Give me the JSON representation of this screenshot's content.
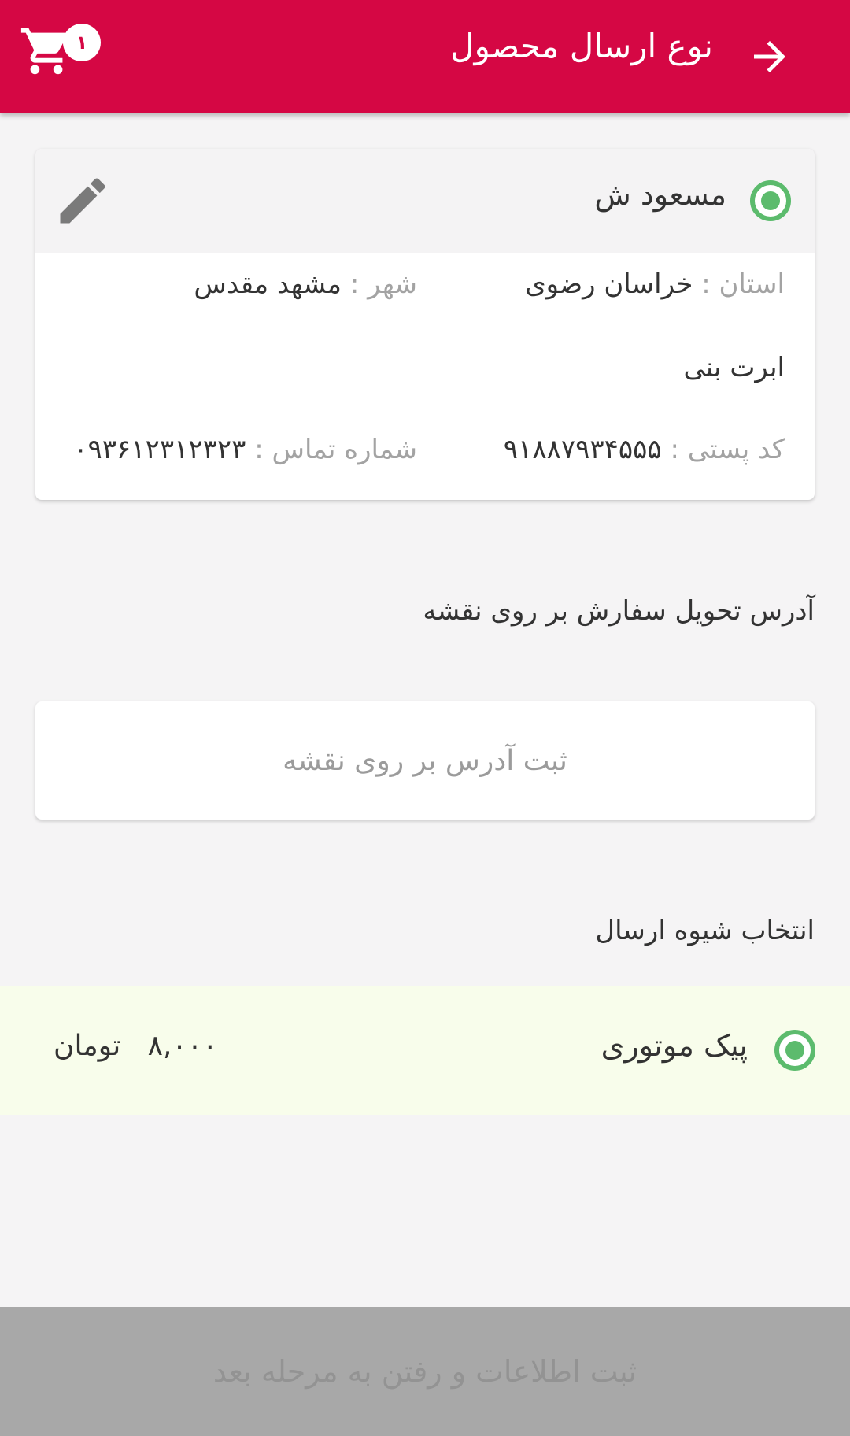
{
  "header": {
    "title": "نوع ارسال محصول",
    "back_icon": "arrow-right-icon",
    "cart_icon": "cart-icon",
    "cart_badge": "۱",
    "color": "#d50744"
  },
  "address_card": {
    "name": "مسعود ش",
    "selected": true,
    "edit_icon": "pencil-icon",
    "province_label": "استان :",
    "province_value": "خراسان رضوی",
    "city_label": "شهر :",
    "city_value": "مشهد مقدس",
    "address": "ابرت بنی",
    "postal_label": "کد پستی :",
    "postal_value": "۹۱۸۸۷۹۳۴۵۵۵",
    "phone_label": "شماره تماس :",
    "phone_value": "۰۹۳۶۱۲۳۱۲۳۲۳"
  },
  "map_section": {
    "title": "آدرس تحویل سفارش بر روی نقشه",
    "button_label": "ثبت آدرس بر روی نقشه"
  },
  "shipping_section": {
    "title": "انتخاب شیوه ارسال",
    "options": [
      {
        "name": "پیک موتوری",
        "price": "۸,۰۰۰",
        "currency": "تومان",
        "selected": true
      }
    ]
  },
  "footer": {
    "submit_label": "ثبت اطلاعات و رفتن به مرحله بعد"
  },
  "colors": {
    "accent": "#d50744",
    "radio": "#5cbb6d",
    "selected_row_bg": "#f8fdeb",
    "disabled_button": "#a8a8a8"
  }
}
